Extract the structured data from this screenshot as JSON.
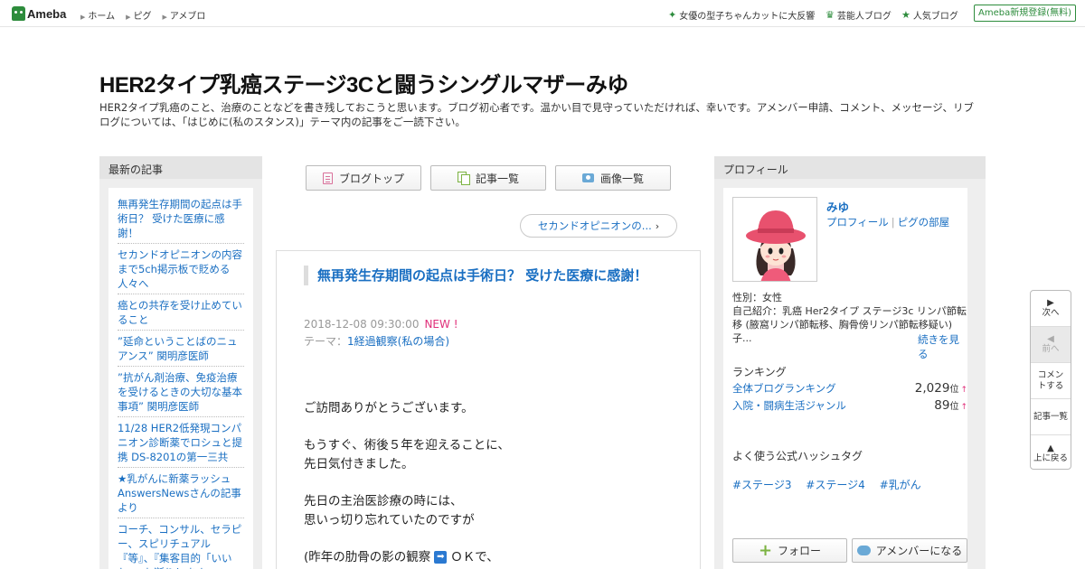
{
  "header": {
    "logo_text": "Ameba",
    "nav": [
      "ホーム",
      "ピグ",
      "アメブロ"
    ],
    "trends": [
      {
        "icon": "sparkle-icon",
        "label": "女優の型子ちゃんカットに大反響"
      },
      {
        "icon": "crown-icon",
        "label": "芸能人ブログ"
      },
      {
        "icon": "star-icon",
        "label": "人気ブログ"
      }
    ],
    "register_label": "Ameba新規登録(無料)"
  },
  "blog": {
    "title": "HER2タイプ乳癌ステージ3Cと闘うシングルマザーみゆ",
    "description": "HER2タイプ乳癌のこと、治療のことなどを書き残しておこうと思います。ブログ初心者です。温かい目で見守っていただければ、幸いです。アメンバー申請、コメント、メッセージ、リブログについては、「はじめに(私のスタンス)」テーマ内の記事をご一読下さい。"
  },
  "left_sidebar": {
    "heading": "最新の記事",
    "entries": [
      "無再発生存期間の起点は手術日？ 受けた医療に感謝！",
      "セカンドオピニオンの内容まで5ch掲示板で貶める人々へ",
      "癌との共存を受け止めていること",
      "”延命ということばのニュアンス” 関明彦医師",
      "”抗がん剤治療、免疫治療を受けるときの大切な基本事項” 関明彦医師",
      "11/28 HER2低発現コンパニオン診断薬でロシュと提携 DS-8201の第一三共",
      "★乳がんに新薬ラッシュ AnswersNewsさんの記事より",
      "コーチ、コンサル、セラピー、スピリチュアル『等』、『集客目的「いいね」』お断りします"
    ]
  },
  "center": {
    "nav_buttons": [
      {
        "icon": "document-icon",
        "label": "ブログトップ"
      },
      {
        "icon": "list-icon",
        "label": "記事一覧"
      },
      {
        "icon": "camera-icon",
        "label": "画像一覧"
      }
    ],
    "prev_entry_label": "セカンドオピニオンの...",
    "entry": {
      "title": "無再発生存期間の起点は手術日？ 受けた医療に感謝！",
      "date": "2018-12-08 09:30:00",
      "new_badge": "NEW !",
      "theme_label": "テーマ：",
      "theme_link": "1経過観察(私の場合)",
      "body": {
        "p1": "ご訪問ありがとうございます。",
        "p2a": "もうすぐ、術後５年を迎えることに、",
        "p2b": "先日気付きました。",
        "p3a": "先日の主治医診療の時には、",
        "p3b": "思いっ切り忘れていたのですが",
        "p4a": "(昨年の肋骨の影の観察",
        "p4b": "ＯＫで、"
      }
    }
  },
  "right_sidebar": {
    "heading": "プロフィール",
    "name": "みゆ",
    "links": [
      "プロフィール",
      "ピグの部屋"
    ],
    "gender": "性別：女性",
    "intro": "自己紹介：乳癌 Her2タイプ ステージ3c リンパ節転移 (腋窩リンパ節転移、胸骨傍リンパ節転移疑い)子...",
    "more_label": "続きを見る",
    "ranking_heading": "ランキング",
    "rankings": [
      {
        "label": "全体ブログランキング",
        "value": "2,029",
        "unit": "位",
        "trend": "↑"
      },
      {
        "label": "入院・闘病生活ジャンル",
        "value": "89",
        "unit": "位",
        "trend": "↑"
      }
    ],
    "hashtag_heading": "よく使う公式ハッシュタグ",
    "hashtags": [
      "#ステージ3",
      "#ステージ4",
      "#乳がん"
    ],
    "follow_label": "フォロー",
    "amember_label": "アメンバーになる"
  },
  "float_nav": {
    "next": "次へ",
    "prev": "前へ",
    "comment": "コメントする",
    "entries": "記事一覧",
    "top": "上に戻る"
  },
  "colors": {
    "brand_green": "#2d8c3c",
    "link_blue": "#1a6fc2",
    "new_pink": "#e0307a"
  }
}
